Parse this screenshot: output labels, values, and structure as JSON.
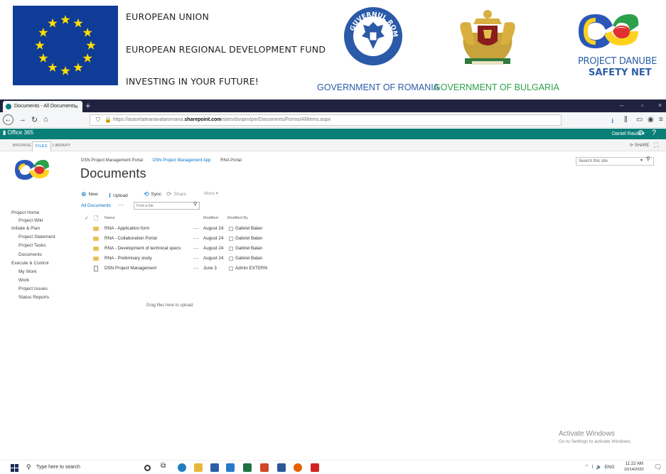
{
  "banner": {
    "eu_line1": "EUROPEAN UNION",
    "eu_line2": "EUROPEAN REGIONAL DEVELOPMENT FUND",
    "eu_line3": "INVESTING IN YOUR FUTURE!",
    "gov_romania": "GOVERNMENT OF ROMANIA",
    "gov_bulgaria": "GOVERNMENT OF  BULGARIA",
    "project_line1": "PROJECT DANUBE",
    "project_line2": "SAFETY NET",
    "seal_text": "GUVERNUL ROMÂNIEI",
    "colors": {
      "eu_blue": "#0f3c96",
      "eu_star": "#ffdd00",
      "romania_blue": "#2a5aa8",
      "bulgaria_green": "#2aa04a",
      "project_blue": "#2d5fa8"
    }
  },
  "browser": {
    "tab_title": "Documents - All Documents",
    "tab_close": "×",
    "new_tab": "+",
    "window_controls": [
      "–",
      "▫",
      "×"
    ],
    "url_prefix": "https://autoritateanavalaromana.",
    "url_domain": "sharepoint.com",
    "url_path": "/sites/dsnpm/pm/Documents/Forms/AllItems.aspx",
    "url_more": "···",
    "toolbar_icons": [
      "download-icon",
      "library-icon",
      "sidebar-icon",
      "account-icon",
      "menu-icon"
    ]
  },
  "sharepoint": {
    "o365_label": "Office 365",
    "user_name": "Daniel Rautu ▾",
    "ribbon_tabs": [
      "BROWSE",
      "FILES",
      "LIBRARY"
    ],
    "share_label": "SHARE",
    "breadcrumb": [
      "DSN Project Management Portal",
      "DSN Project Management App",
      "RNA Portal"
    ],
    "page_title": "Documents",
    "search_placeholder": "Search this site",
    "quick_launch": [
      {
        "label": "Project Home",
        "indent": false
      },
      {
        "label": "Project Wiki",
        "indent": true
      },
      {
        "label": "Initiate & Plan",
        "indent": false
      },
      {
        "label": "Project Statement",
        "indent": true
      },
      {
        "label": "Project Tasks",
        "indent": true
      },
      {
        "label": "Documents",
        "indent": true
      },
      {
        "label": "Execute & Control",
        "indent": false
      },
      {
        "label": "My Work",
        "indent": true
      },
      {
        "label": "Work",
        "indent": true
      },
      {
        "label": "Project Issues",
        "indent": true
      },
      {
        "label": "Status Reports",
        "indent": true
      }
    ],
    "commands": {
      "new": "New",
      "upload": "Upload",
      "sync": "Sync",
      "share": "Share",
      "more": "More ▾"
    },
    "view_label": "All Documents",
    "view_dots": "···",
    "find_placeholder": "Find a file",
    "columns": {
      "name": "Name",
      "modified": "Modified",
      "modified_by": "Modified By"
    },
    "documents": [
      {
        "name": "RNA - Application form",
        "type": "folder",
        "modified": "August 24",
        "modified_by": "Gabriel Balan"
      },
      {
        "name": "RNA - Collaboration Portal",
        "type": "folder",
        "modified": "August 24",
        "modified_by": "Gabriel Balan"
      },
      {
        "name": "RNA - Development of technical specs",
        "type": "folder",
        "modified": "August 24",
        "modified_by": "Gabriel Balan"
      },
      {
        "name": "RNA - Preliminary study",
        "type": "folder",
        "modified": "August 24",
        "modified_by": "Gabriel Balan"
      },
      {
        "name": "DSN Project Management",
        "type": "file",
        "modified": "June 3",
        "modified_by": "Admin EXTERN"
      }
    ],
    "drag_hint": "Drag files here to upload",
    "accent": "#0072c6",
    "suite_bar_color": "#0a7f78"
  },
  "watermark": {
    "line1": "Activate Windows",
    "line2": "Go to Settings to activate Windows."
  },
  "taskbar": {
    "search_placeholder": "Type here to search",
    "tray_lang": "ENG",
    "time": "11:22 AM",
    "date": "10/14/2020",
    "pinned_apps": [
      "cortana-icon",
      "task-view-icon",
      "edge-icon",
      "file-explorer-icon",
      "store-icon",
      "mail-icon",
      "excel-icon",
      "powerpoint-icon",
      "word-icon",
      "firefox-icon",
      "acrobat-icon"
    ]
  }
}
